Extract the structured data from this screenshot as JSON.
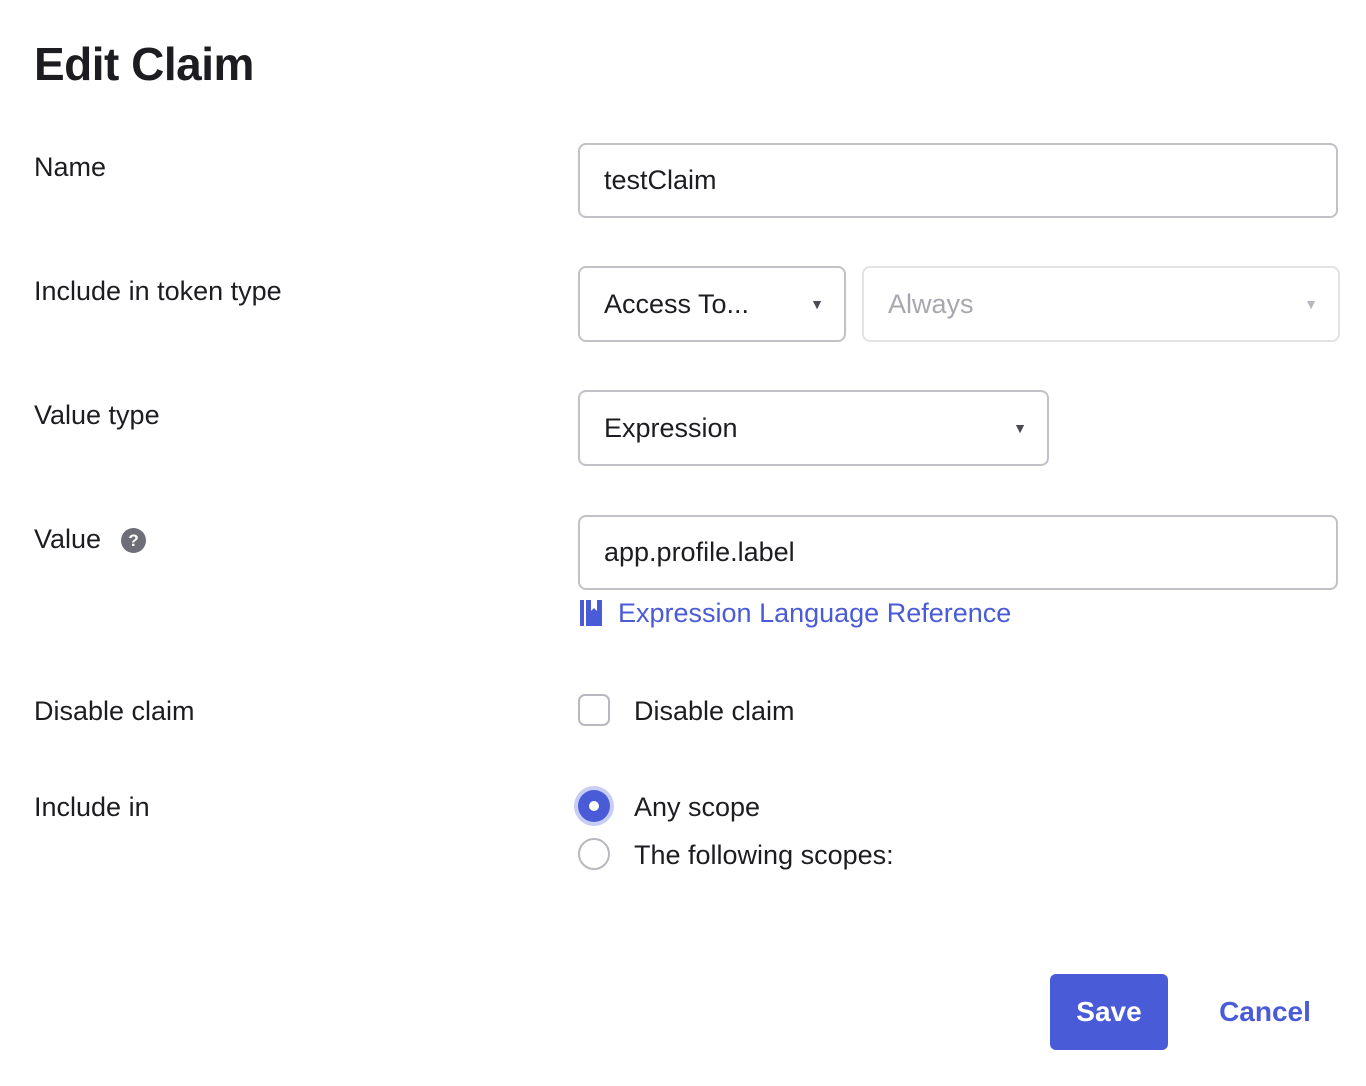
{
  "title": "Edit Claim",
  "fields": {
    "name": {
      "label": "Name",
      "value": "testClaim"
    },
    "token_type": {
      "label": "Include in token type",
      "token_select": "Access To...",
      "frequency_select": "Always"
    },
    "value_type": {
      "label": "Value type",
      "selected": "Expression"
    },
    "value": {
      "label": "Value",
      "help_icon": "?",
      "input": "app.profile.label",
      "link_text": "Expression Language Reference"
    },
    "disable_claim": {
      "label": "Disable claim",
      "checkbox_label": "Disable claim",
      "checked": false
    },
    "include_in": {
      "label": "Include in",
      "options": [
        {
          "label": "Any scope",
          "checked": true
        },
        {
          "label": "The following scopes:",
          "checked": false
        }
      ]
    }
  },
  "actions": {
    "save_label": "Save",
    "cancel_label": "Cancel"
  },
  "colors": {
    "accent": "#4a5bd8",
    "border": "#c1c1c8"
  }
}
